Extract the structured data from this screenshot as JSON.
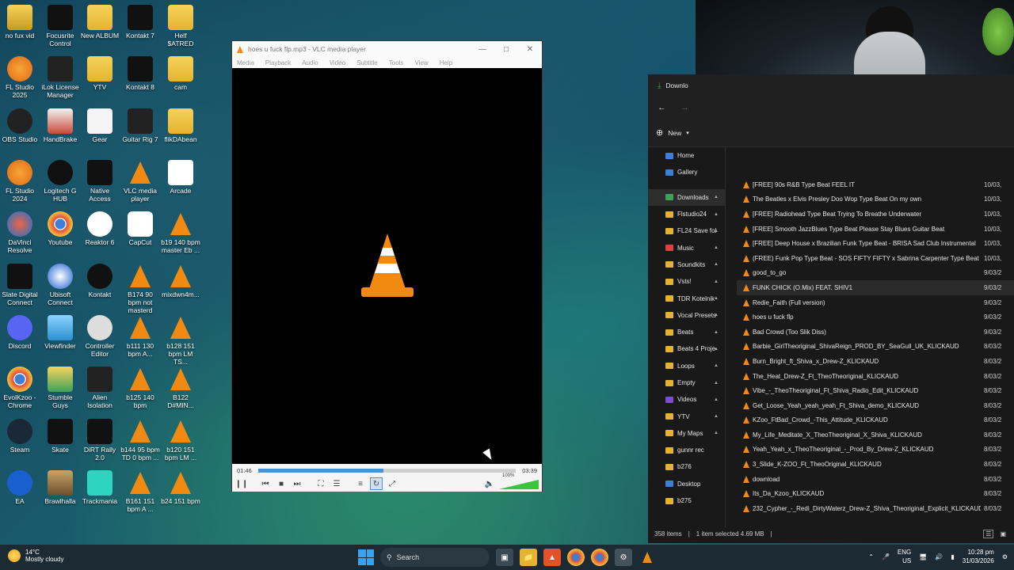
{
  "desktop_icons": [
    {
      "label": "no fux vid",
      "kind": "folder-dark"
    },
    {
      "label": "Focusrite Control",
      "kind": "focusrite"
    },
    {
      "label": "New ALBUM",
      "kind": "folder"
    },
    {
      "label": "Kontakt 7",
      "kind": "kt"
    },
    {
      "label": "Helf $ATRED",
      "kind": "folder"
    },
    {
      "label": "FL Studio 2025",
      "kind": "fl"
    },
    {
      "label": "iLok License Manager",
      "kind": "ilok"
    },
    {
      "label": "YTV",
      "kind": "folder"
    },
    {
      "label": "Kontakt 8",
      "kind": "kt"
    },
    {
      "label": "cam",
      "kind": "folder"
    },
    {
      "label": "OBS Studio",
      "kind": "obs"
    },
    {
      "label": "HandBrake",
      "kind": "handbrake"
    },
    {
      "label": "Gear",
      "kind": "doc"
    },
    {
      "label": "Guitar Rig 7",
      "kind": "gr"
    },
    {
      "label": "flikDAbean",
      "kind": "folder"
    },
    {
      "label": "FL Studio 2024",
      "kind": "fl"
    },
    {
      "label": "Logitech G HUB",
      "kind": "ghub"
    },
    {
      "label": "Native Access",
      "kind": "ni"
    },
    {
      "label": "VLC media player",
      "kind": "vlc"
    },
    {
      "label": "Arcade",
      "kind": "arcade"
    },
    {
      "label": "DaVinci Resolve",
      "kind": "davinci"
    },
    {
      "label": "Youtube",
      "kind": "chrome"
    },
    {
      "label": "Reaktor 6",
      "kind": "reaktor"
    },
    {
      "label": "CapCut",
      "kind": "capcut"
    },
    {
      "label": "b19 140 bpm master Eb ...",
      "kind": "vlc"
    },
    {
      "label": "Slate Digital Connect",
      "kind": "slate"
    },
    {
      "label": "Ubisoft Connect",
      "kind": "ubisoft"
    },
    {
      "label": "Kontakt",
      "kind": "kontakt"
    },
    {
      "label": "B174 90 bpm not masterd",
      "kind": "vlc"
    },
    {
      "label": "mixdwn4m...",
      "kind": "vlc"
    },
    {
      "label": "Discord",
      "kind": "discord"
    },
    {
      "label": "Viewfinder",
      "kind": "viewfinder"
    },
    {
      "label": "Controller Editor",
      "kind": "controller"
    },
    {
      "label": "b111 130 bpm A...",
      "kind": "vlc"
    },
    {
      "label": "b128 151 bpm LM TS...",
      "kind": "vlc"
    },
    {
      "label": "EvolKzoo - Chrome",
      "kind": "chrome"
    },
    {
      "label": "Stumble Guys",
      "kind": "stumble"
    },
    {
      "label": "Alien Isolation",
      "kind": "alien"
    },
    {
      "label": "b125 140 bpm",
      "kind": "vlc"
    },
    {
      "label": "B122 D#MIN...",
      "kind": "vlc"
    },
    {
      "label": "Steam",
      "kind": "steam"
    },
    {
      "label": "Skate",
      "kind": "skate"
    },
    {
      "label": "DiRT Rally 2.0",
      "kind": "dirt"
    },
    {
      "label": "b144 95 bpm TD 0 bpm ...",
      "kind": "vlc"
    },
    {
      "label": "b120 151 bpm LM ...",
      "kind": "vlc"
    },
    {
      "label": "EA",
      "kind": "ea"
    },
    {
      "label": "Brawlhalla",
      "kind": "brawlhalla"
    },
    {
      "label": "Trackmania",
      "kind": "trackmania"
    },
    {
      "label": "B161 151 bpm A ...",
      "kind": "vlc"
    },
    {
      "label": "b24 151 bpm",
      "kind": "vlc"
    }
  ],
  "vlc": {
    "title": "hoes u fuck flp.mp3 - VLC media player",
    "menu": [
      "Media",
      "Playback",
      "Audio",
      "Video",
      "Subtitle",
      "Tools",
      "View",
      "Help"
    ],
    "time_elapsed": "01:46",
    "time_total": "03:39",
    "progress": 0.485,
    "volume_label": "100%",
    "volume": 1.0,
    "accent": "#4b8fd6"
  },
  "explorer": {
    "tab_title": "Downlo",
    "new_label": "New",
    "sidebar": [
      {
        "label": "Home",
        "color": "#3c7fd4",
        "pin": false
      },
      {
        "label": "Gallery",
        "color": "#3c7fd4",
        "pin": false
      },
      {
        "label": "Downloads",
        "color": "#3fa15b",
        "pin": true,
        "active": true
      },
      {
        "label": "Flstudio24",
        "color": "#e6b32e",
        "pin": true
      },
      {
        "label": "FL24 Save fol",
        "color": "#e6b32e",
        "pin": true
      },
      {
        "label": "Music",
        "color": "#d9453c",
        "pin": true
      },
      {
        "label": "Soundkits",
        "color": "#e6b32e",
        "pin": true
      },
      {
        "label": "Vsts!",
        "color": "#e6b32e",
        "pin": true
      },
      {
        "label": "TDR Kotelnik",
        "color": "#e6b32e",
        "pin": true
      },
      {
        "label": "Vocal Presets",
        "color": "#e6b32e",
        "pin": true
      },
      {
        "label": "Beats",
        "color": "#e6b32e",
        "pin": true
      },
      {
        "label": "Beats 4 Proje",
        "color": "#e6b32e",
        "pin": true
      },
      {
        "label": "Loops",
        "color": "#e6b32e",
        "pin": true
      },
      {
        "label": "Empty",
        "color": "#e6b32e",
        "pin": true
      },
      {
        "label": "Videos",
        "color": "#7a4fc9",
        "pin": true
      },
      {
        "label": "YTV",
        "color": "#e6b32e",
        "pin": true
      },
      {
        "label": "My Maps",
        "color": "#e6b32e",
        "pin": true
      },
      {
        "label": "gunnr rec",
        "color": "#e6b32e",
        "pin": false
      },
      {
        "label": "b276",
        "color": "#e6b32e",
        "pin": false
      },
      {
        "label": "Desktop",
        "color": "#3c7fd4",
        "pin": false
      },
      {
        "label": "b275",
        "color": "#e6b32e",
        "pin": false
      }
    ],
    "files": [
      {
        "name": "[FREE] 90s R&B Type Beat FEEL IT",
        "date": "10/03,"
      },
      {
        "name": "The Beatles x Elvis Presley Doo Wop Type Beat  On my own",
        "date": "10/03,"
      },
      {
        "name": "[FREE] Radiohead Type Beat  Trying To Breathe Underwater",
        "date": "10/03,"
      },
      {
        "name": "[FREE] Smooth JazzBlues Type Beat  Please Stay  Blues Guitar Beat",
        "date": "10/03,"
      },
      {
        "name": "[FREE] Deep House x Brazilian Funk Type Beat - BRISA  Sad Club Instrumental",
        "date": "10/03,"
      },
      {
        "name": "(FREE) Funk Pop Type Beat - SOS  FIFTY FIFTY x Sabrina Carpenter Type Beat",
        "date": "10/03,"
      },
      {
        "name": "good_to_go",
        "date": "9/03/2"
      },
      {
        "name": "FUNK CHICK (O.Mix) FEAT. SHIV1",
        "date": "9/03/2",
        "selected": true
      },
      {
        "name": "Redie_Faith (Full version)",
        "date": "9/03/2"
      },
      {
        "name": "hoes u fuck flp",
        "date": "9/03/2"
      },
      {
        "name": "Bad Crowd (Too Slik Diss)",
        "date": "9/03/2"
      },
      {
        "name": "Barbie_GirlTheoriginal_ShivaReign_PROD_BY_SeaGull_UK_KLICKAUD",
        "date": "8/03/2"
      },
      {
        "name": "Burn_Bright_ft_Shiva_x_Drew-Z_KLICKAUD",
        "date": "8/03/2"
      },
      {
        "name": "The_Heat_Drew-Z_Ft_TheoTheoriginal_KLICKAUD",
        "date": "8/03/2"
      },
      {
        "name": "Vibe_-_TheoTheoriginal_Ft_Shiva_Radio_Edit_KLICKAUD",
        "date": "8/03/2"
      },
      {
        "name": "Get_Loose_Yeah_yeah_yeah_Ft_Shiva_demo_KLICKAUD",
        "date": "8/03/2"
      },
      {
        "name": "KZoo_FtBad_Crowd_-This_Attitude_KLICKAUD",
        "date": "8/03/2"
      },
      {
        "name": "My_Life_Meditate_X_TheoTheoriginal_X_Shiva_KLICKAUD",
        "date": "8/03/2"
      },
      {
        "name": "Yeah_Yeah_x_TheoTheoriginal_-_Prod_By_Drew-Z_KLICKAUD",
        "date": "8/03/2"
      },
      {
        "name": "3_Slide_K-ZOO_Ft_TheoOriginal_KLICKAUD",
        "date": "8/03/2"
      },
      {
        "name": "download",
        "date": "8/03/2"
      },
      {
        "name": "Its_Da_Kzoo_KLICKAUD",
        "date": "8/03/2"
      },
      {
        "name": "232_Cypher_-_Redi_DirtyWaterz_Drew-Z_Shiva_Theoriginal_Explicit_KLICKAUD",
        "date": "8/03/2"
      }
    ],
    "status": {
      "count": "358 items",
      "selected": "1 item selected  4.69 MB"
    }
  },
  "taskbar": {
    "weather_temp": "14°C",
    "weather_desc": "Mostly cloudy",
    "search_placeholder": "Search",
    "lang1": "ENG",
    "lang2": "US",
    "time": "10:28 pm",
    "date": "31/03/2026"
  }
}
